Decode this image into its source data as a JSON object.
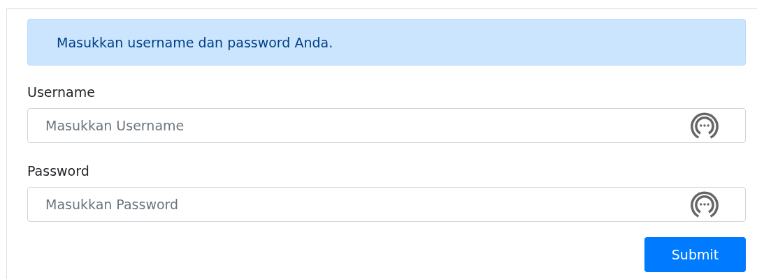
{
  "alert": {
    "text": "Masukkan username dan password Anda."
  },
  "fields": [
    {
      "label": "Username",
      "placeholder": "Masukkan Username"
    },
    {
      "label": "Password",
      "placeholder": "Masukkan Password"
    }
  ],
  "buttons": [
    "Submit"
  ]
}
